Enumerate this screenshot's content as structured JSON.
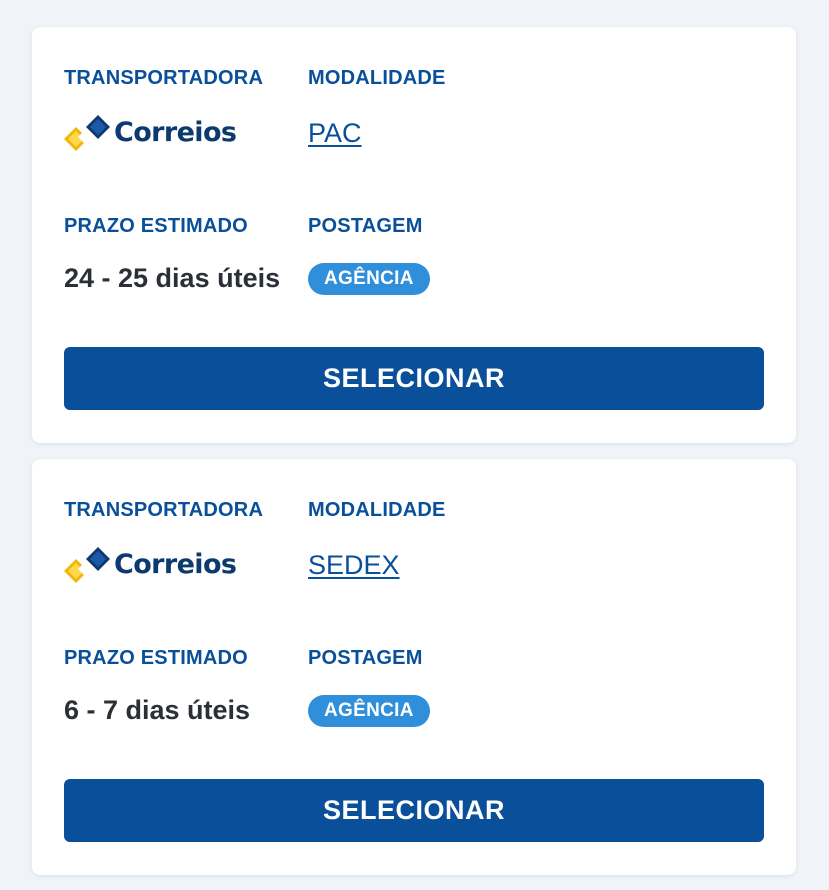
{
  "colors": {
    "page_background": "#f0f4f8",
    "card_background": "#ffffff",
    "label_blue": "#0a4f99",
    "button_blue": "#0a4f99",
    "badge_blue": "#2f8fdb",
    "logo_yellow": "#f2b705",
    "logo_navy": "#0d3a6e",
    "text_dark": "#2b2f36"
  },
  "shipping_options": [
    {
      "carrier_label": "TRANSPORTADORA",
      "carrier_logo_text": "Correios",
      "carrier_logo_icon": "correios-logo-icon",
      "modality_label": "MODALIDADE",
      "modality": "PAC",
      "estimate_label": "PRAZO ESTIMADO",
      "estimate": "24 - 25 dias úteis",
      "posting_label": "POSTAGEM",
      "posting": "AGÊNCIA",
      "select_label": "SELECIONAR"
    },
    {
      "carrier_label": "TRANSPORTADORA",
      "carrier_logo_text": "Correios",
      "carrier_logo_icon": "correios-logo-icon",
      "modality_label": "MODALIDADE",
      "modality": "SEDEX",
      "estimate_label": "PRAZO ESTIMADO",
      "estimate": "6 - 7 dias úteis",
      "posting_label": "POSTAGEM",
      "posting": "AGÊNCIA",
      "select_label": "SELECIONAR"
    }
  ]
}
